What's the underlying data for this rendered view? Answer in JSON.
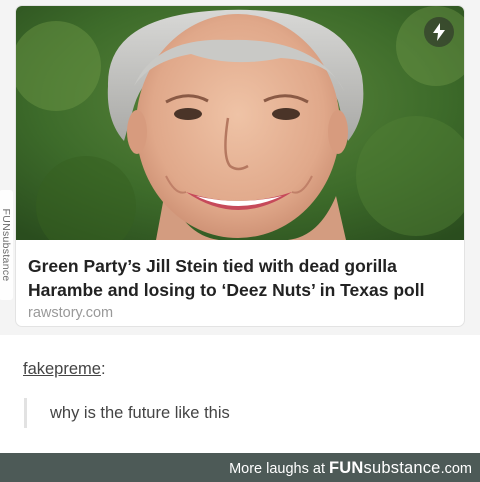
{
  "card": {
    "title": "Green Party’s Jill Stein tied with dead gorilla Harambe and losing to ‘Deez Nuts’ in Texas poll",
    "source": "rawstory.com",
    "badge_icon": "lightning-bolt-icon"
  },
  "watermark": {
    "text": "FUNsubstance"
  },
  "post": {
    "username": "fakepreme",
    "username_suffix": ":",
    "quote": "why is the future like this"
  },
  "footer": {
    "prefix": "More laughs at ",
    "brand_bold": "FUN",
    "brand_rest": "substance",
    "brand_tld": ".com"
  },
  "colors": {
    "footer_bg": "#4d5a57",
    "title": "#222222",
    "source": "#999999"
  }
}
